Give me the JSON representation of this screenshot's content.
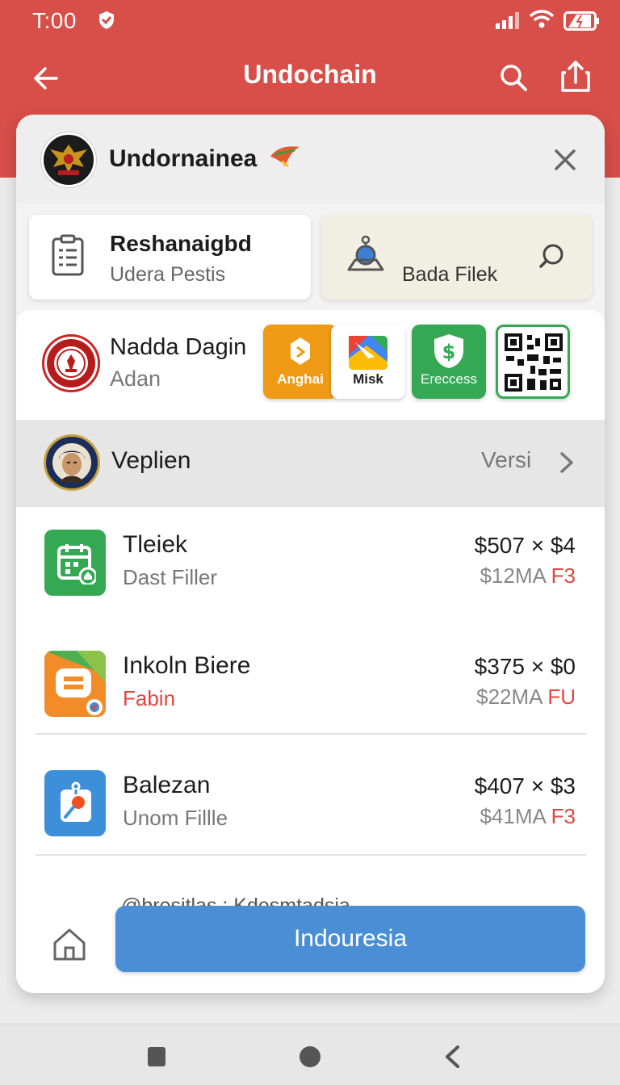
{
  "status": {
    "time": "T:00"
  },
  "appbar": {
    "title": "Undochain"
  },
  "card": {
    "title": "Undornainea",
    "tiles": [
      {
        "title": "Reshanaigbd",
        "subtitle": "Udera Pestis"
      },
      {
        "label": "Bada Filek"
      }
    ]
  },
  "profile": {
    "name": "Nadda Dagin",
    "sub": "Adan",
    "apps": [
      {
        "label": "Anghai",
        "color": "#ef9a14"
      },
      {
        "label": "Misk",
        "color": "#ffffff"
      },
      {
        "label": "Ereccess",
        "color": "#34a853"
      },
      {
        "label": "",
        "color": "#ffffff"
      }
    ]
  },
  "version_row": {
    "name": "Veplien",
    "label": "Versi"
  },
  "items": [
    {
      "title": "Tleiek",
      "subtitle": "Dast Filler",
      "price": "$507 × $4",
      "price2_a": "$12MA",
      "price2_b": "F3",
      "icon_color": "#34a853",
      "sub_red": false
    },
    {
      "title": "Inkoln Biere",
      "subtitle": "Fabin",
      "price": "$375 × $0",
      "price2_a": "$22MA",
      "price2_b": "FU",
      "icon_color": "#f28c28",
      "sub_red": true
    },
    {
      "title": "Balezan",
      "subtitle": "Unom Fillle",
      "price": "$407 × $3",
      "price2_a": "$41MA",
      "price2_b": "F3",
      "icon_color": "#3c8fd8",
      "sub_red": false
    }
  ],
  "footer": {
    "text": "@bresitlas  : Kdesmtadsia",
    "cta": "Indouresia"
  }
}
